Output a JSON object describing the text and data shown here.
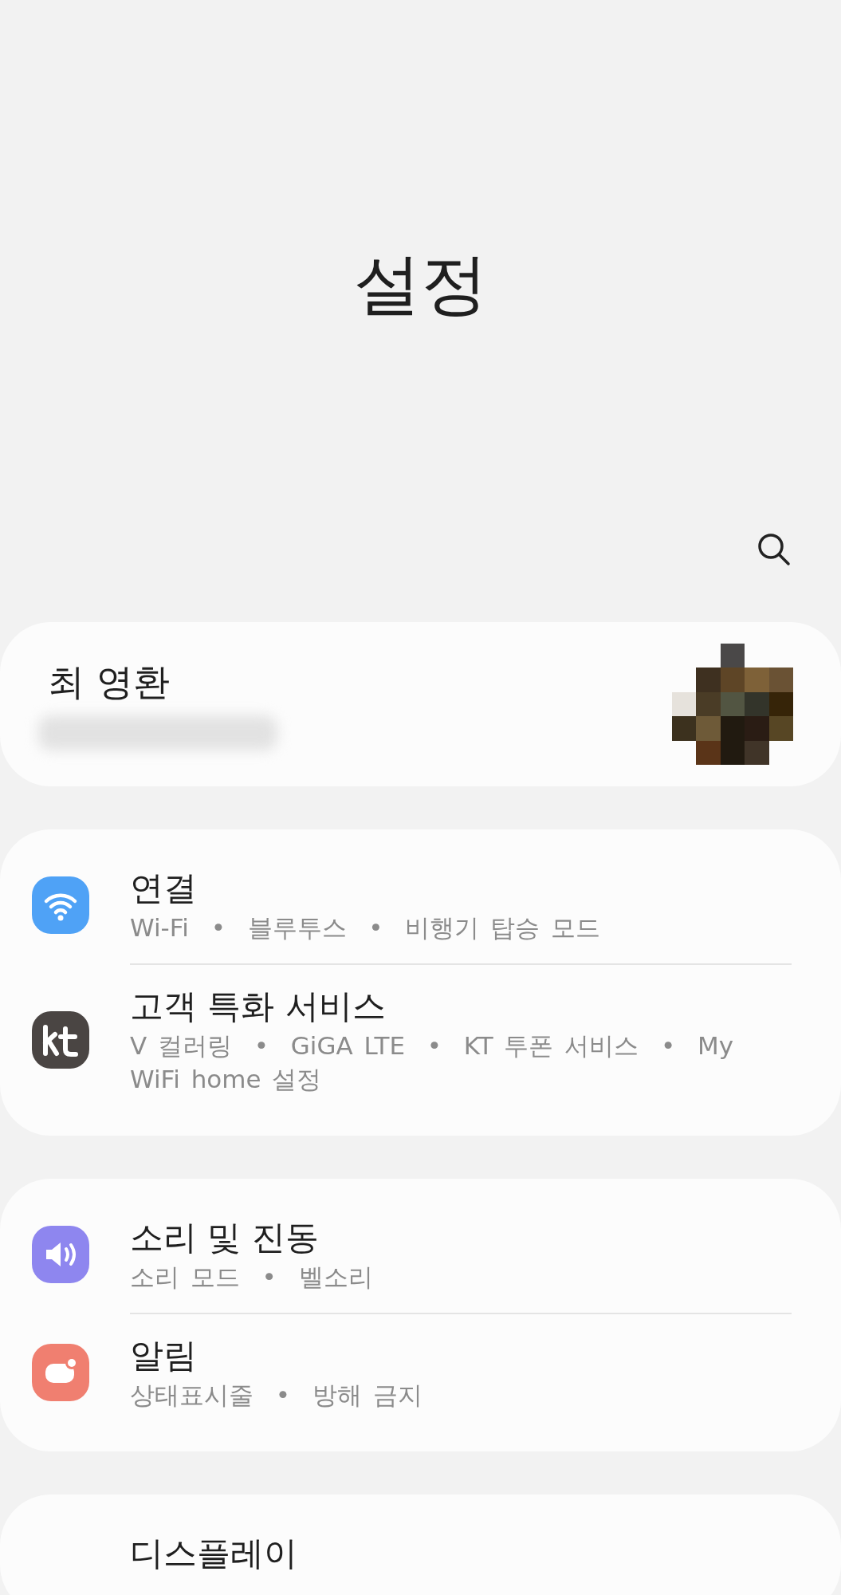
{
  "header": {
    "title": "설정"
  },
  "profile": {
    "name": "최 영환"
  },
  "groups": [
    {
      "items": [
        {
          "kind": "wifi",
          "title": "연결",
          "subtitle": "Wi-Fi  •  블루투스  •  비행기 탑승 모드"
        },
        {
          "kind": "kt",
          "title": "고객 특화 서비스",
          "subtitle": "V 컬러링  •  GiGA LTE  •  KT 투폰 서비스  •  My WiFi home 설정"
        }
      ]
    },
    {
      "items": [
        {
          "kind": "sound",
          "title": "소리 및 진동",
          "subtitle": "소리 모드  •  벨소리"
        },
        {
          "kind": "notification",
          "title": "알림",
          "subtitle": "상태표시줄  •  방해 금지"
        }
      ]
    },
    {
      "items": [
        {
          "title": "디스플레이"
        }
      ]
    }
  ]
}
